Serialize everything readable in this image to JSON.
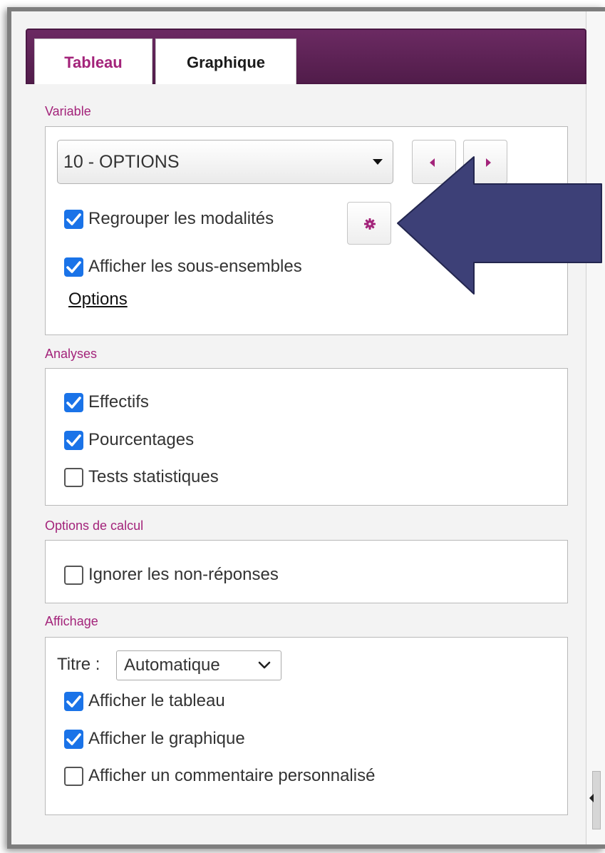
{
  "tabs": [
    {
      "label": "Tableau",
      "active": true
    },
    {
      "label": "Graphique",
      "active": false
    }
  ],
  "variable": {
    "section_label": "Variable",
    "selected": "10 - OPTIONS",
    "group_label": "Regrouper les modalités",
    "group_checked": true,
    "subsets_label": "Afficher les sous-ensembles",
    "subsets_checked": true,
    "options_link": "Options"
  },
  "analyses": {
    "section_label": "Analyses",
    "items": [
      {
        "label": "Effectifs",
        "checked": true
      },
      {
        "label": "Pourcentages",
        "checked": true
      },
      {
        "label": "Tests statistiques",
        "checked": false
      }
    ]
  },
  "calcul": {
    "section_label": "Options de calcul",
    "items": [
      {
        "label": "Ignorer les non-réponses",
        "checked": false
      }
    ]
  },
  "affichage": {
    "section_label": "Affichage",
    "titre_label": "Titre :",
    "titre_value": "Automatique",
    "items": [
      {
        "label": "Afficher le tableau",
        "checked": true
      },
      {
        "label": "Afficher le graphique",
        "checked": true
      },
      {
        "label": "Afficher un commentaire personnalisé",
        "checked": false
      }
    ]
  },
  "icons": {
    "prev": "triangle-left-icon",
    "next": "triangle-right-icon",
    "settings": "gear-icon",
    "dropdown": "caret-down-icon",
    "annotation": "arrow-left-annotation"
  },
  "colors": {
    "accent": "#a3237a",
    "tab_bar": "#5a1f52",
    "checkbox": "#1a73e8",
    "annotation_arrow": "#3d4077"
  }
}
